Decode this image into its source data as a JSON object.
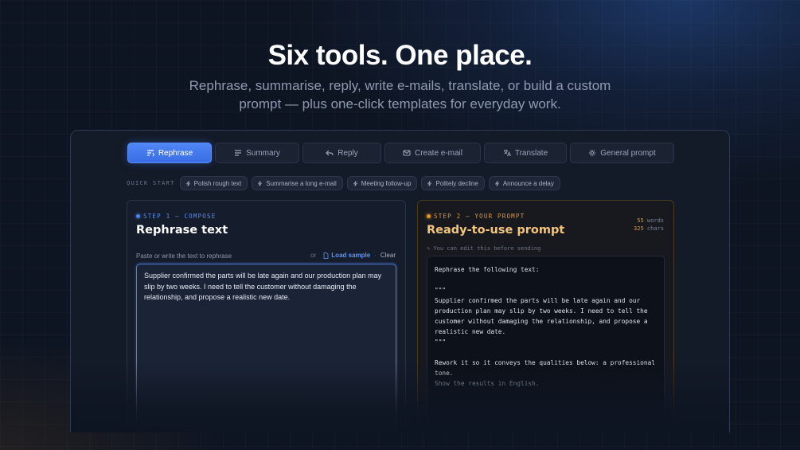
{
  "hero": {
    "title": "Six tools. One place.",
    "subtitle": "Rephrase, summarise, reply, write e-mails, translate, or build a custom prompt — plus one-click templates for everyday work."
  },
  "tabs": [
    {
      "label": "Rephrase",
      "icon": "rephrase-icon",
      "active": true
    },
    {
      "label": "Summary",
      "icon": "summary-icon"
    },
    {
      "label": "Reply",
      "icon": "reply-icon"
    },
    {
      "label": "Create e-mail",
      "icon": "mail-icon"
    },
    {
      "label": "Translate",
      "icon": "translate-icon"
    },
    {
      "label": "General prompt",
      "icon": "gear-icon"
    }
  ],
  "quick_start": {
    "label": "QUICK START",
    "chips": [
      "Polish rough text",
      "Summarise a long e-mail",
      "Meeting follow-up",
      "Politely decline",
      "Announce a delay"
    ]
  },
  "compose": {
    "step": "STEP 1 — COMPOSE",
    "title": "Rephrase text",
    "hint": "Paste or write the text to rephrase",
    "or": "or",
    "load_sample": "Load sample",
    "separator": "·",
    "clear": "Clear",
    "text": "Supplier confirmed the parts will be late again and our production plan may slip by two weeks. I need to tell the customer without damaging the relationship, and propose a realistic new date."
  },
  "prompt": {
    "step": "STEP 2 — YOUR PROMPT",
    "title": "Ready-to-use prompt",
    "words": "55",
    "words_label": "words",
    "chars": "325",
    "chars_label": "chars",
    "edit_note": "✎ You can edit this before sending",
    "body": "Rephrase the following text:\n\n\"\"\"\nSupplier confirmed the parts will be late again and our production plan may slip by two weeks. I need to tell the customer without damaging the relationship, and propose a realistic new date.\n\"\"\"\n\nRework it so it conveys the qualities below: a professional tone.",
    "language_line": "Show the results in English."
  },
  "colors": {
    "accent": "#4f86f5",
    "prompt_accent": "#f4c57c",
    "background": "#0e1522"
  }
}
